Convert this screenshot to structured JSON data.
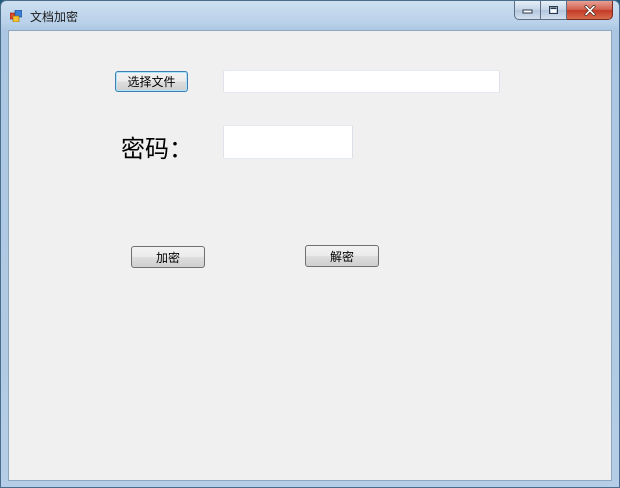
{
  "window": {
    "title": "文档加密",
    "controls": {
      "minimize_icon": "minimize-icon",
      "maximize_icon": "maximize-icon",
      "close_icon": "close-icon"
    }
  },
  "form": {
    "select_file_button": "选择文件",
    "file_path_value": "",
    "password_label": "密码：",
    "password_value": "",
    "encrypt_button": "加密",
    "decrypt_button": "解密"
  },
  "colors": {
    "client_background": "#f0f0f0",
    "titlebar_gradient_top": "#cddff0",
    "close_button_red": "#c23a26",
    "focus_border": "#3c7fb1"
  }
}
